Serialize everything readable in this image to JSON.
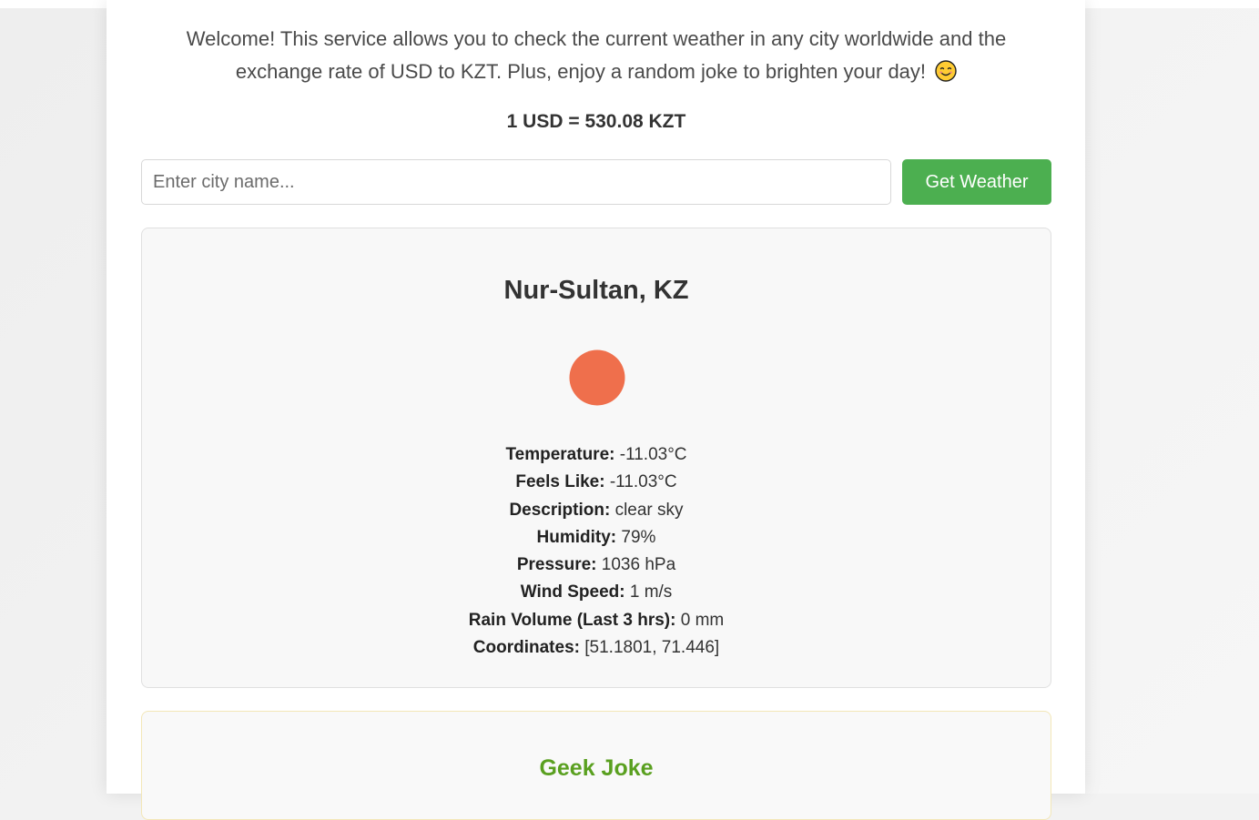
{
  "intro": {
    "line1": "Welcome! This service allows you to check the current weather in any city worldwide and the",
    "line2": "exchange rate of USD to KZT. Plus, enjoy a random joke to brighten your day!",
    "emoji_icon": "smiling-face-icon"
  },
  "exchange": {
    "rate_text": "1 USD = 530.08 KZT"
  },
  "search": {
    "placeholder": "Enter city name...",
    "value": "",
    "button_label": "Get Weather",
    "button_color": "#4caf50"
  },
  "weather": {
    "city": "Nur-Sultan, KZ",
    "icon": "sun-icon",
    "icon_color": "#ef6f4c",
    "details": [
      {
        "label": "Temperature:",
        "value": "-11.03°C"
      },
      {
        "label": "Feels Like:",
        "value": "-11.03°C"
      },
      {
        "label": "Description:",
        "value": "clear sky"
      },
      {
        "label": "Humidity:",
        "value": "79%"
      },
      {
        "label": "Pressure:",
        "value": "1036 hPa"
      },
      {
        "label": "Wind Speed:",
        "value": "1 m/s"
      },
      {
        "label": "Rain Volume (Last 3 hrs):",
        "value": "0 mm"
      },
      {
        "label": "Coordinates:",
        "value": "[51.1801, 71.446]"
      }
    ]
  },
  "joke": {
    "title": "Geek Joke",
    "title_color": "#5aa020"
  }
}
